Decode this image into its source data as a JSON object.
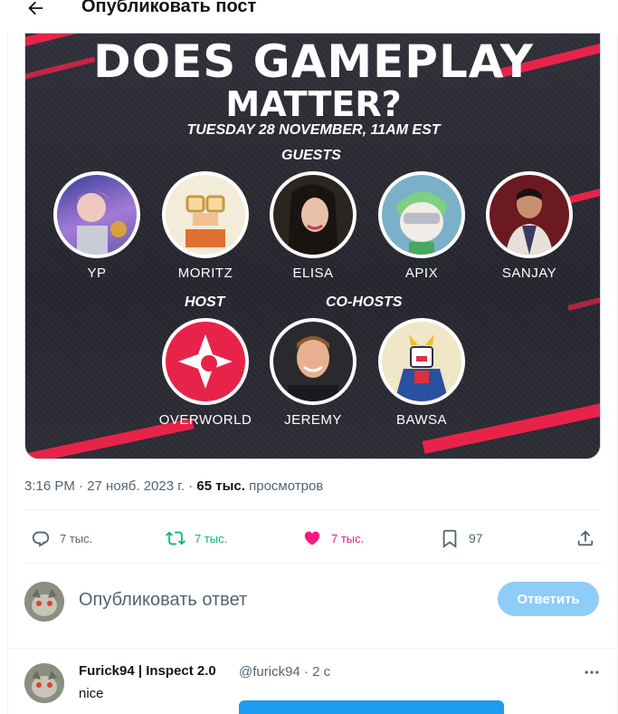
{
  "header": {
    "title": "Опубликовать пост",
    "back_icon": "arrow-left-icon"
  },
  "media": {
    "headline_1": "DOES GAMEPLAY",
    "headline_2": "MATTER?",
    "date": "TUESDAY 28 NOVEMBER, 11AM EST",
    "guests_label": "GUESTS",
    "host_label": "HOST",
    "cohosts_label": "CO-HOSTS",
    "guests": [
      "YP",
      "MORITZ",
      "ELISA",
      "APIX",
      "SANJAY"
    ],
    "host": "OVERWORLD",
    "cohosts": [
      "JEREMY",
      "BAWSA"
    ],
    "accent": "#e8234a"
  },
  "meta": {
    "time": "3:16 PM · 27 нояб. 2023 г. · ",
    "views": "65 тыс.",
    "views_label": " просмотров"
  },
  "actions": {
    "replies": "7 тыс.",
    "reposts": "7 тыс.",
    "likes": "7 тыс.",
    "bookmarks": "97",
    "colors": {
      "repost": "#00ba7c",
      "like": "#f91880",
      "default": "#536471"
    }
  },
  "composer": {
    "placeholder": "Опубликовать ответ",
    "button": "Ответить"
  },
  "reply": {
    "name": "Furick94 | Inspect 2.0",
    "handle": "@furick94 · 2 с",
    "text": "nice"
  }
}
